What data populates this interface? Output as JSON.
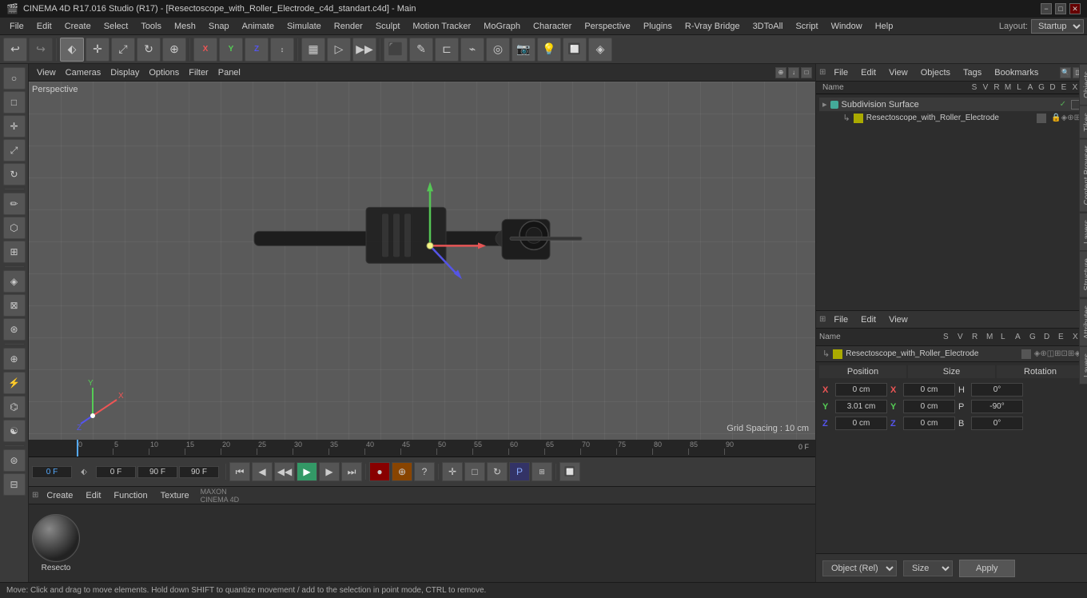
{
  "window": {
    "title": "CINEMA 4D R17.016 Studio (R17) - [Resectoscope_with_Roller_Electrode_c4d_standart.c4d] - Main"
  },
  "titlebar": {
    "title": "CINEMA 4D R17.016 Studio (R17) - [Resectoscope_with_Roller_Electrode_c4d_standart.c4d] - Main",
    "controls": [
      "−",
      "□",
      "✕"
    ]
  },
  "menubar": {
    "items": [
      "File",
      "Edit",
      "Create",
      "Select",
      "Tools",
      "Mesh",
      "Snap",
      "Animate",
      "Simulate",
      "Render",
      "Sculpt",
      "Motion Tracker",
      "MoGraph",
      "Character",
      "Perspective",
      "Plugins",
      "R-Vray Bridge",
      "3DToAll",
      "Script",
      "Window",
      "Help"
    ],
    "layout_label": "Layout:",
    "layout_value": "Startup"
  },
  "viewport": {
    "label": "Perspective",
    "grid_spacing": "Grid Spacing : 10 cm",
    "menus": [
      "View",
      "Cameras",
      "Display",
      "Options",
      "Filter",
      "Panel"
    ]
  },
  "objects_panel": {
    "title": "Objects",
    "menus": [
      "File",
      "Edit",
      "View",
      "Objects",
      "Tags",
      "Bookmarks"
    ],
    "columns": [
      "Name",
      "S",
      "V",
      "R",
      "M",
      "L",
      "A",
      "G",
      "D",
      "E",
      "X"
    ],
    "tree": [
      {
        "name": "Subdivision Surface",
        "type": "subdivision",
        "indent": 0,
        "has_check": true,
        "has_green": true
      },
      {
        "name": "Resectoscope_with_Roller_Electrode",
        "type": "object",
        "indent": 1,
        "has_yellow": true
      }
    ]
  },
  "attributes_panel": {
    "title": "Attributes",
    "menus": [
      "File",
      "Edit",
      "View"
    ],
    "object_name": "Resectoscope_with_Roller_Electrode",
    "columns": [
      "Name",
      "S",
      "V",
      "R",
      "M",
      "L",
      "A",
      "G",
      "D",
      "E",
      "X"
    ],
    "position": {
      "label": "Position",
      "x": {
        "label": "X",
        "value": "0 cm"
      },
      "y": {
        "label": "Y",
        "value": "3.01 cm"
      },
      "z": {
        "label": "Z",
        "value": "0 cm"
      }
    },
    "size": {
      "label": "Size",
      "x": {
        "label": "X",
        "value": "0 cm"
      },
      "y": {
        "label": "Y",
        "value": "0 cm"
      },
      "z": {
        "label": "Z",
        "value": "0 cm"
      }
    },
    "rotation": {
      "label": "Rotation",
      "h": {
        "label": "H",
        "value": "0°"
      },
      "p": {
        "label": "P",
        "value": "-90°"
      },
      "b": {
        "label": "B",
        "value": "0°"
      }
    },
    "object_selector": "Object (Rel)",
    "size_selector": "Size",
    "apply_label": "Apply"
  },
  "timeline": {
    "frames": [
      "0",
      "5",
      "10",
      "15",
      "20",
      "25",
      "30",
      "35",
      "40",
      "45",
      "50",
      "55",
      "60",
      "65",
      "70",
      "75",
      "80",
      "85",
      "90"
    ],
    "current_frame": "0 F",
    "start_frame": "0 F",
    "end_frame": "90 F",
    "preview_end": "90 F"
  },
  "material_editor": {
    "menus": [
      "Create",
      "Edit",
      "Function",
      "Texture"
    ],
    "material_name": "Resecto"
  },
  "statusbar": {
    "text": "Move: Click and drag to move elements. Hold down SHIFT to quantize movement / add to the selection in point mode, CTRL to remove."
  },
  "right_tabs": [
    "Objects",
    "Tikes",
    "Content Browser",
    "Layers",
    "Structure",
    "Attributes",
    "Layers"
  ]
}
